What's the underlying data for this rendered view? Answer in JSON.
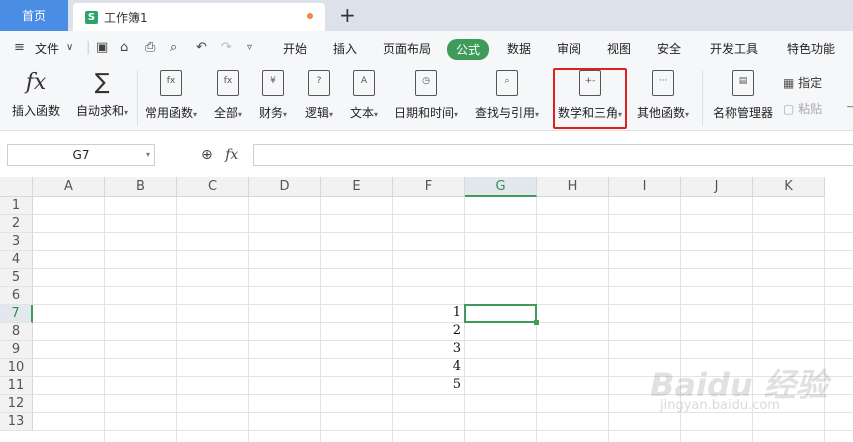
{
  "tabs": {
    "home": "首页",
    "doc_title": "工作簿1",
    "doc_icon": "S",
    "add": "+"
  },
  "menu": {
    "file": "文件",
    "items": [
      "开始",
      "插入",
      "页面布局",
      "公式",
      "数据",
      "审阅",
      "视图",
      "安全",
      "开发工具",
      "特色功能"
    ],
    "active": "公式"
  },
  "ribbon": {
    "insert_function": "插入函数",
    "autosum": "自动求和",
    "common": "常用函数",
    "all": "全部",
    "finance": "财务",
    "logic": "逻辑",
    "text": "文本",
    "datetime": "日期和时间",
    "lookup": "查找与引用",
    "math": "数学和三角",
    "other": "其他函数",
    "name_manager": "名称管理器",
    "specify": "指定",
    "paste": "粘贴"
  },
  "formula_bar": {
    "name_box": "G7",
    "fx": "fx",
    "value": ""
  },
  "columns": [
    "A",
    "B",
    "C",
    "D",
    "E",
    "F",
    "G",
    "H",
    "I",
    "J",
    "K"
  ],
  "rows": [
    "1",
    "2",
    "3",
    "4",
    "5",
    "6",
    "7",
    "8",
    "9",
    "10",
    "11",
    "12",
    "13"
  ],
  "selected_column": "G",
  "selected_row": "7",
  "cells": {
    "F7": "1",
    "F8": "2",
    "F9": "3",
    "F10": "4",
    "F11": "5"
  },
  "colors": {
    "accent": "#3f9b5a",
    "home_tab": "#4a8de5",
    "highlight": "#e02020"
  },
  "watermark": {
    "brand": "Baidu 经验",
    "url": "jingyan.baidu.com"
  }
}
